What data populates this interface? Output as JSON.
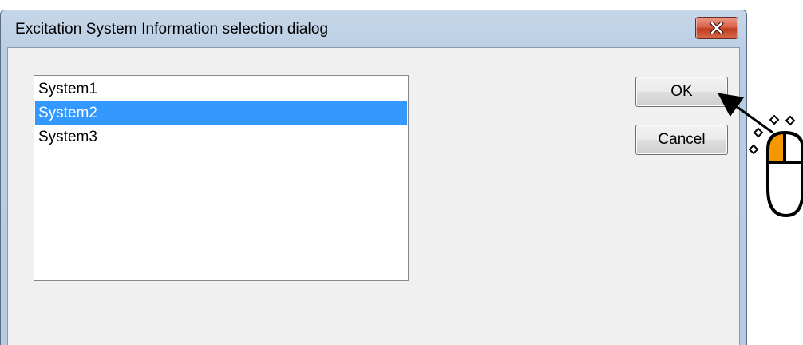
{
  "window": {
    "title": "Excitation System Information selection dialog"
  },
  "listbox": {
    "items": [
      {
        "label": "System1",
        "selected": false
      },
      {
        "label": "System2",
        "selected": true
      },
      {
        "label": "System3",
        "selected": false
      }
    ],
    "selected_color": "#3399ff"
  },
  "buttons": {
    "ok_label": "OK",
    "cancel_label": "Cancel"
  },
  "close_button": {
    "icon": "close-icon",
    "color": "#c13d22"
  },
  "annotation": {
    "icon": "mouse-left-click-icon",
    "highlight_color": "#f39800"
  }
}
